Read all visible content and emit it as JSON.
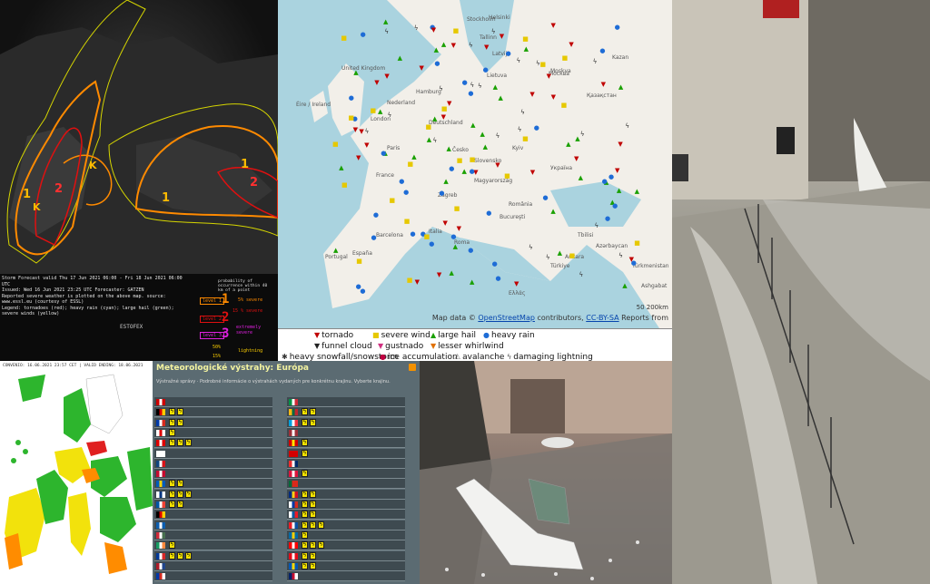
{
  "estofex": {
    "caption_lines": [
      "Storm Forecast valid Thu 17 Jun 2021 06:00 - Fri 18 Jun 2021 06:00 UTC",
      "Issued: Wed 16 Jun 2021 23:25 UTC  Forecaster: GATZEN",
      "Reported severe weather is plotted on the above map. source: www.essl.eu (courtesy of ESSL)",
      "Legend: tornadoes (red); heavy rain (cyan); large hail (green); severe winds (yellow)"
    ],
    "logo_text": "ESTOFEX",
    "legend_heading": "probability of occurrence within 40 km of a point",
    "level1": "level 1",
    "level1_num": "1",
    "level2": "level 2",
    "level2_num": "2",
    "level3": "level 3",
    "level3_num": "3",
    "extremely_severe": "extremely severe",
    "pct5": "5% severe",
    "pct15": "15 % severe",
    "pct50": "50%",
    "pct15b": "15%",
    "lightning": "lightning",
    "map_labels": [
      "1",
      "2",
      "K",
      "K",
      "1",
      "1",
      "2"
    ]
  },
  "osm": {
    "cities": [
      "Stockholm",
      "Helsinki",
      "Tallinn",
      "Latvija",
      "Lietuva",
      "Moskva",
      "Kazan",
      "United Kingdom",
      "Éire / Ireland",
      "London",
      "Hamburg",
      "Deutschland",
      "Nederland",
      "Paris",
      "France",
      "Česko",
      "Slovensko",
      "Magyarország",
      "România",
      "Kyiv",
      "Україна",
      "Zagreb",
      "Bucureşti",
      "Italia",
      "Roma",
      "España",
      "Portugal",
      "Barcelona",
      "Türkiye",
      "Ankara",
      "Ελλάς",
      "Қазақстан",
      "Türkmenistan",
      "Ashgabat",
      "Azərbaycan",
      "Tbilisi",
      "Москва"
    ],
    "scale": "50 200km",
    "attrib_prefix": "Map data ©",
    "attrib_link1": "OpenStreetMap",
    "attrib_middle": "contributors,",
    "attrib_link2": "CC-BY-SA",
    "attrib_suffix": "Reports from",
    "legend": [
      {
        "label": "tornado",
        "color": "#c00000",
        "symbol": "▼"
      },
      {
        "label": "severe wind",
        "color": "#e6c800",
        "symbol": "■"
      },
      {
        "label": "large hail",
        "color": "#19a000",
        "symbol": "▲"
      },
      {
        "label": "heavy rain",
        "color": "#1e6cd6",
        "symbol": "●"
      },
      {
        "label": "funnel cloud",
        "color": "#222",
        "symbol": "▼"
      },
      {
        "label": "gustnado",
        "color": "#d03080",
        "symbol": "▼"
      },
      {
        "label": "lesser whirlwind",
        "color": "#e07000",
        "symbol": "▼"
      },
      {
        "label": "heavy snowfall/snowstorm",
        "color": "#333",
        "symbol": "✱"
      },
      {
        "label": "ice accumulation",
        "color": "#c00040",
        "symbol": "●"
      },
      {
        "label": "avalanche",
        "color": "#666",
        "symbol": "⚠"
      },
      {
        "label": "damaging lightning",
        "color": "#555",
        "symbol": "ϟ"
      }
    ]
  },
  "meteomap": {
    "header": "CONVENIO: 16.06.2021 23:57 CET | VALID ENDING: 18.06.2021"
  },
  "table": {
    "title": "Meteorologické výstrahy: Európa",
    "subtitle": "Výstražné správy · Podrobné informácie o výstrahách vydaných pre konkrétnu krajinu. Vyberte krajinu.",
    "rss_icon": "rss-icon",
    "left_flags": [
      [
        "#c00",
        "#fff",
        "#c00"
      ],
      [
        "#000",
        "#d00",
        "#fc0"
      ],
      [
        "#0039a6",
        "#fff",
        "#d52b1e"
      ],
      [
        "#fff",
        "#d00",
        "#fff"
      ],
      [
        "#d00",
        "#fff",
        "#d00"
      ],
      [
        "#fff",
        "#fff",
        "#fff"
      ],
      [
        "#11457e",
        "#fff",
        "#d7141a"
      ],
      [
        "#c60c30",
        "#fff",
        "#c60c30"
      ],
      [
        "#005bbb",
        "#ffd500",
        "#005bbb"
      ],
      [
        "#fff",
        "#003580",
        "#fff"
      ],
      [
        "#0055a4",
        "#fff",
        "#ef4135"
      ],
      [
        "#000",
        "#dd0000",
        "#ffce00"
      ],
      [
        "#0d5eaf",
        "#fff",
        "#0d5eaf"
      ],
      [
        "#ce2939",
        "#fff",
        "#477050"
      ],
      [
        "#169b62",
        "#fff",
        "#ff883e"
      ],
      [
        "#003897",
        "#fff",
        "#d72828"
      ],
      [
        "#ae1c28",
        "#fff",
        "#21468b"
      ],
      [
        "#0039a6",
        "#d52b1e",
        "#fff"
      ]
    ],
    "right_flags": [
      [
        "#009246",
        "#fff",
        "#ce2b37"
      ],
      [
        "#fdb913",
        "#006a44",
        "#c1272d"
      ],
      [
        "#00a1de",
        "#fff",
        "#ef3340"
      ],
      [
        "#9e3039",
        "#fff",
        "#9e3039"
      ],
      [
        "#d20000",
        "#ffe600",
        "#d20000"
      ],
      [
        "#d20000",
        "#d20000",
        "#d20000"
      ],
      [
        "#ef2b2d",
        "#fff",
        "#002868"
      ],
      [
        "#dc143c",
        "#fff",
        "#dc143c"
      ],
      [
        "#046a38",
        "#da291c",
        "#da291c"
      ],
      [
        "#002b7f",
        "#fcd116",
        "#ce1126"
      ],
      [
        "#fff",
        "#0039a6",
        "#d52b1e"
      ],
      [
        "#fff",
        "#005da4",
        "#ed1c24"
      ],
      [
        "#ee1c25",
        "#fff",
        "#0b4ea2"
      ],
      [
        "#006aa7",
        "#fecc00",
        "#006aa7"
      ],
      [
        "#ff0000",
        "#fff",
        "#ff0000"
      ],
      [
        "#e30a17",
        "#fff",
        "#e30a17"
      ],
      [
        "#0057b7",
        "#ffd700",
        "#0057b7"
      ],
      [
        "#012169",
        "#c8102e",
        "#fff"
      ]
    ]
  },
  "photos": {
    "flood": "flooded street photo",
    "hail": "hailstorm garden photo"
  }
}
